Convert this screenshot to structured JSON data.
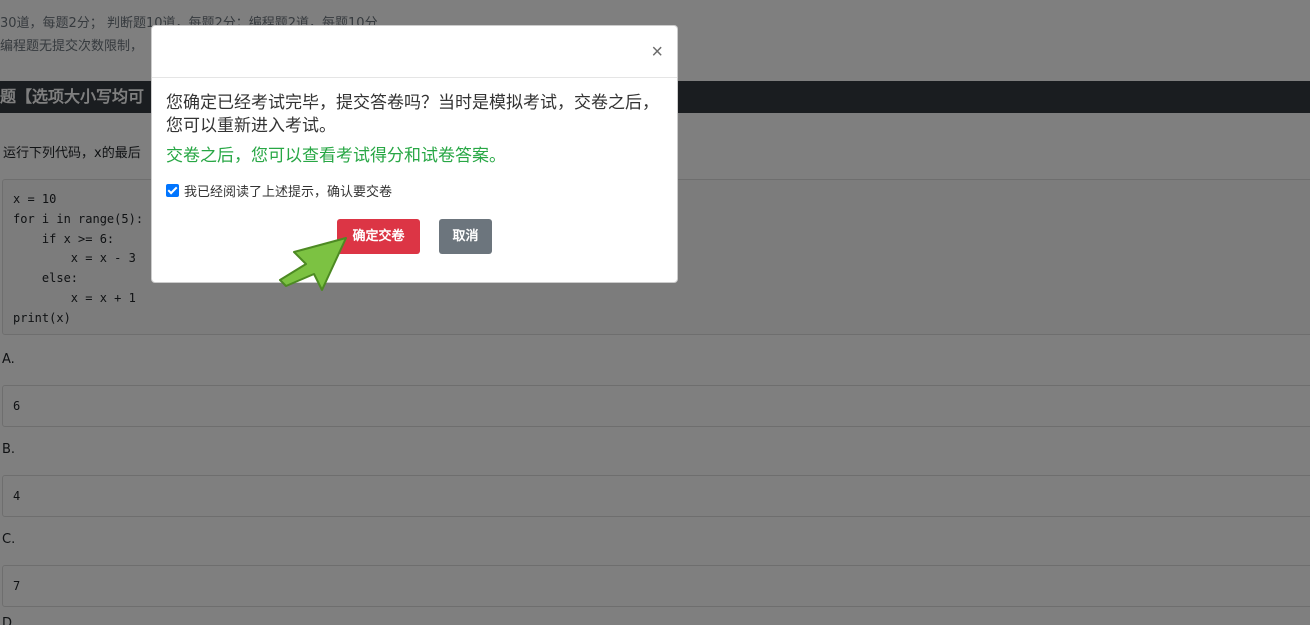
{
  "page": {
    "info_line1": "30道，每题2分； 判断题10道，每题2分；编程题2道，每题10分",
    "info_line2": "编程题无提交次数限制，",
    "section_title": "题【选项大小写均可",
    "question": "运行下列代码，x的最后",
    "code": "x = 10\nfor i in range(5):\n    if x >= 6:\n        x = x - 3\n    else:\n        x = x + 1\nprint(x)",
    "options": [
      {
        "label": "A.",
        "value": "6"
      },
      {
        "label": "B.",
        "value": "4"
      },
      {
        "label": "C.",
        "value": "7"
      },
      {
        "label": "D.",
        "value": ""
      }
    ]
  },
  "modal": {
    "close_symbol": "×",
    "message": "您确定已经考试完毕，提交答卷吗？当时是模拟考试，交卷之后，您可以重新进入考试。",
    "green_message": "交卷之后，您可以查看考试得分和试卷答案。",
    "checkbox_label": "我已经阅读了上述提示，确认要交卷",
    "checkbox_checked": true,
    "confirm_button": "确定交卷",
    "cancel_button": "取消"
  },
  "colors": {
    "confirm": "#dc3545",
    "cancel": "#6c757d",
    "green_text": "#28a745",
    "section_header": "#343a40",
    "arrow": "#7cc242"
  },
  "icons": {
    "pointer": "green-arrow-icon",
    "close": "close-icon"
  }
}
